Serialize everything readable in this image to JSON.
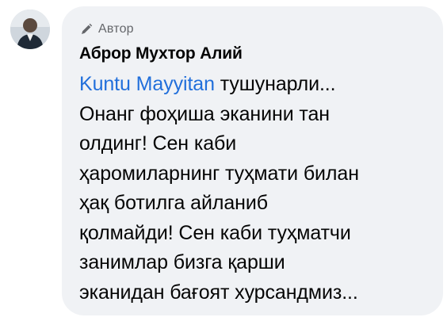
{
  "comment": {
    "author_badge": "Автор",
    "author_name": "Аброр Мухтор Алий",
    "mention": "Kuntu Mayyitan",
    "lines": [
      " тушунарли...",
      "Онанг фоҳиша эканини тан",
      "олдинг! Сен каби",
      "ҳаромиларнинг туҳмати билан",
      "ҳақ ботилга айланиб",
      "қолмайди! Сен каби туҳматчи",
      "занимлар бизга қарши",
      "эканидан бағоят хурсандмиз..."
    ]
  },
  "icons": {
    "badge": "pen-icon",
    "avatar": "avatar-photo"
  },
  "colors": {
    "bubble_background": "#f0f2f5",
    "mention_link": "#216fdb",
    "badge_text": "#65676b",
    "text": "#050505"
  }
}
